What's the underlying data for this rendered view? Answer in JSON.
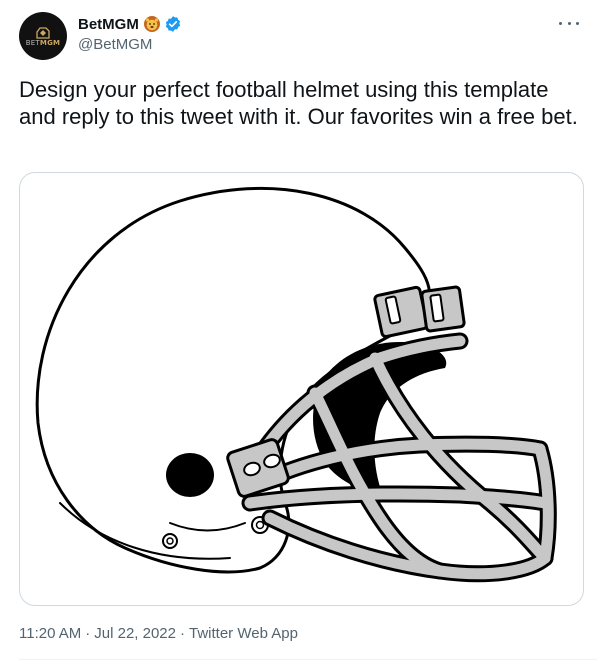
{
  "tweet": {
    "author": {
      "display_name": "BetMGM",
      "handle": "@BetMGM",
      "avatar_text_bet": "BET",
      "avatar_text_mgm": "MGM",
      "name_emoji_icon": "lion-icon",
      "verified_icon": "verified-badge-icon"
    },
    "text": "Design your perfect football helmet using this template and reply to this tweet with it. Our favorites win a free bet.",
    "media": {
      "type": "image",
      "subject_icon": "football-helmet-outline-icon"
    },
    "timestamp_time": "11:20 AM",
    "timestamp_date": "Jul 22, 2022",
    "separator": "·",
    "source": "Twitter Web App"
  },
  "colors": {
    "text_primary": "#0f1419",
    "text_secondary": "#536471",
    "verified_blue": "#1d9bf0",
    "border": "#cfd9de",
    "avatar_bg": "#111111",
    "avatar_gold": "#c9a961"
  }
}
